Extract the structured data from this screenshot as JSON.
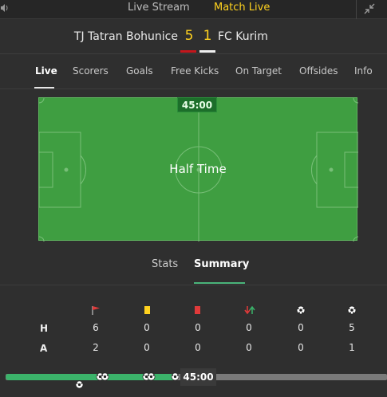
{
  "topbar": {
    "tabs": [
      {
        "label": "Live Stream"
      },
      {
        "label": "Match Live"
      }
    ]
  },
  "score": {
    "home_team": "TJ Tatran Bohunice",
    "home_score": "5",
    "away_score": "1",
    "away_team": "FC Kurim"
  },
  "nav": {
    "items": [
      {
        "label": "Live"
      },
      {
        "label": "Scorers"
      },
      {
        "label": "Goals"
      },
      {
        "label": "Free Kicks"
      },
      {
        "label": "On Target"
      },
      {
        "label": "Offsides"
      },
      {
        "label": "Info"
      }
    ]
  },
  "pitch": {
    "clock": "45:00",
    "status": "Half Time"
  },
  "subtabs": {
    "stats": "Stats",
    "summary": "Summary"
  },
  "summary": {
    "icons": [
      "corner-flag-icon",
      "yellow-card-icon",
      "red-card-icon",
      "substitution-icon",
      "goal-icon",
      "goal-icon"
    ],
    "rows": [
      {
        "label": "H",
        "values": [
          "6",
          "0",
          "0",
          "0",
          "0",
          "5"
        ]
      },
      {
        "label": "A",
        "values": [
          "2",
          "0",
          "0",
          "0",
          "0",
          "1"
        ]
      }
    ]
  },
  "timeline": {
    "time": "45:00",
    "progress": 0.5
  },
  "colors": {
    "accent_yellow": "#ffd21f",
    "home_bar": "#c4161c",
    "pitch_green": "#3f9e41",
    "progress_green": "#3bb36a"
  }
}
